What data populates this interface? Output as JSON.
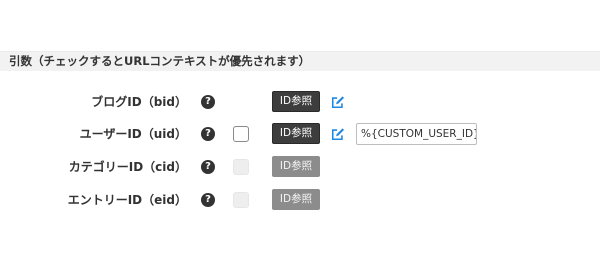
{
  "section": {
    "title": "引数（チェックするとURLコンテキストが優先されます）"
  },
  "rows": [
    {
      "label": "ブログID（bid）",
      "help": "?",
      "button": "ID参照"
    },
    {
      "label": "ユーザーID（uid）",
      "help": "?",
      "button": "ID参照",
      "input_value": "%{CUSTOM_USER_ID}"
    },
    {
      "label": "カテゴリーID（cid）",
      "help": "?",
      "button": "ID参照"
    },
    {
      "label": "エントリーID（eid）",
      "help": "?",
      "button": "ID参照"
    }
  ],
  "icons": {
    "help": "question-circle-icon",
    "edit": "pencil-square-icon"
  },
  "colors": {
    "accent": "#1e88e5",
    "button_dark": "#3d3d3d",
    "button_disabled": "#8c8c8c"
  }
}
